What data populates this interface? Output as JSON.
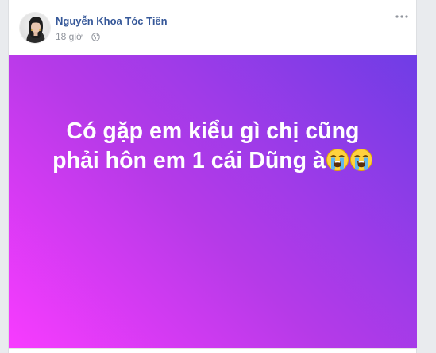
{
  "post": {
    "author": "Nguyễn Khoa Tóc Tiên",
    "time": "18 giờ",
    "separator": "·",
    "privacy_icon": "globe-icon",
    "avatar_icon": "avatar",
    "more_icon": "more-options-icon",
    "text_lines": [
      "Có gặp em kiểu gì chị cũng",
      "phải hôn em 1 cái Dũng à"
    ],
    "emoji_icons": [
      "loudly-crying-face-icon",
      "loudly-crying-face-icon"
    ],
    "background_gradient": [
      "#f83bff",
      "#b63ae8",
      "#6f3de6"
    ],
    "author_color": "#365899",
    "meta_color": "#90949c"
  }
}
